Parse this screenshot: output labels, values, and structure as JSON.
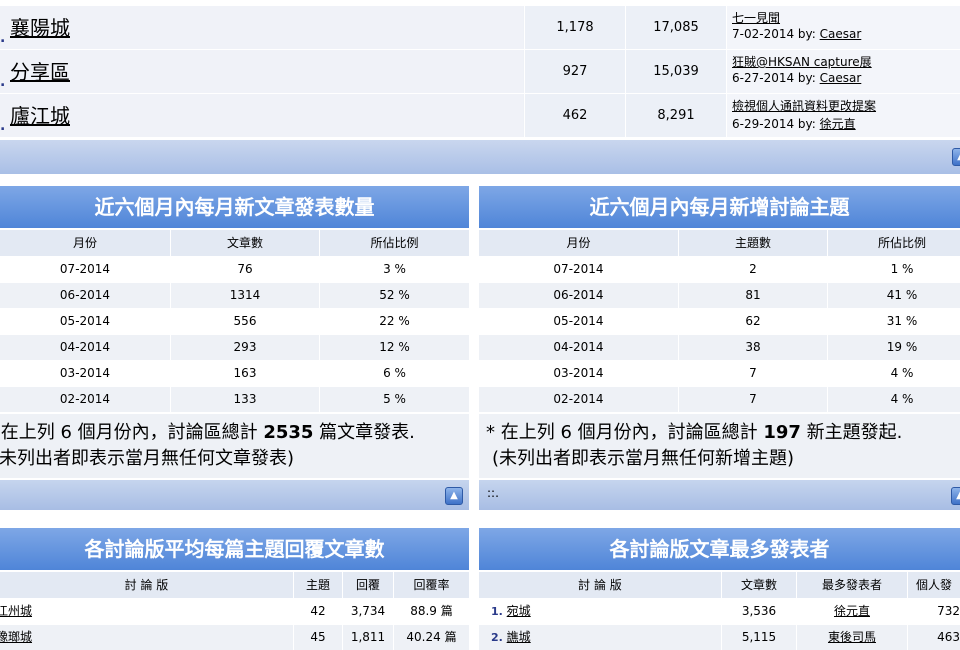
{
  "forums": [
    {
      "name": "襄陽城",
      "topics": "1,178",
      "posts": "17,085",
      "last_title": "七一見聞",
      "last_date": "7-02-2014 by:",
      "last_user": "Caesar"
    },
    {
      "name": "分享區",
      "topics": "927",
      "posts": "15,039",
      "last_title": "狂賊@HKSAN capture展",
      "last_date": "6-27-2014 by:",
      "last_user": "Caesar"
    },
    {
      "name": "廬江城",
      "topics": "462",
      "posts": "8,291",
      "last_title": "檢視個人通訊資料更改提案",
      "last_date": "6-29-2014 by:",
      "last_user": "徐元直"
    }
  ],
  "posts_panel": {
    "title": "近六個月內每月新文章發表數量",
    "headers": [
      "月份",
      "文章數",
      "所佔比例"
    ],
    "rows": [
      [
        "07-2014",
        "76",
        "3 %"
      ],
      [
        "06-2014",
        "1314",
        "52 %"
      ],
      [
        "05-2014",
        "556",
        "22 %"
      ],
      [
        "04-2014",
        "293",
        "12 %"
      ],
      [
        "03-2014",
        "163",
        "6 %"
      ],
      [
        "02-2014",
        "133",
        "5 %"
      ]
    ],
    "note_line1_pre": "* 在上列 6 個月份內，討論區總計 ",
    "note_total": "2535",
    "note_line1_post": " 篇文章發表.",
    "note_line2": "(未列出者即表示當月無任何文章發表)"
  },
  "topics_panel": {
    "title": "近六個月內每月新增討論主題",
    "headers": [
      "月份",
      "主題數",
      "所佔比例"
    ],
    "rows": [
      [
        "07-2014",
        "2",
        "1 %"
      ],
      [
        "06-2014",
        "81",
        "41 %"
      ],
      [
        "05-2014",
        "62",
        "31 %"
      ],
      [
        "04-2014",
        "38",
        "19 %"
      ],
      [
        "03-2014",
        "7",
        "4 %"
      ],
      [
        "02-2014",
        "7",
        "4 %"
      ]
    ],
    "note_line1_pre": "* 在上列 6 個月份內，討論區總計 ",
    "note_total": "197",
    "note_line1_post": " 新主題發起.",
    "note_line2": "(未列出者即表示當月無任何新增主題)",
    "footer_text": "::."
  },
  "replies_panel": {
    "title": "各討論版平均每篇主題回覆文章數",
    "headers": [
      "討 論 版",
      "主題",
      "回覆",
      "回覆率"
    ],
    "rows": [
      [
        "江州城",
        "42",
        "3,734",
        "88.9 篇"
      ],
      [
        "豫瑯城",
        "45",
        "1,811",
        "40.24 篇"
      ]
    ]
  },
  "top_poster_panel": {
    "title": "各討論版文章最多發表者",
    "headers": [
      "討 論 版",
      "文章數",
      "最多發表者",
      "個人發"
    ],
    "rows": [
      [
        "1.",
        "宛城",
        "3,536",
        "徐元直",
        "732"
      ],
      [
        "2.",
        "譙城",
        "5,115",
        "東後司馬",
        "463"
      ]
    ]
  },
  "icons": {
    "up": "up-arrow-icon"
  },
  "colors": {
    "header_blue": "#4f85d8",
    "row_alt": "#eef1f6",
    "footer_blue": "#a8bde4"
  }
}
